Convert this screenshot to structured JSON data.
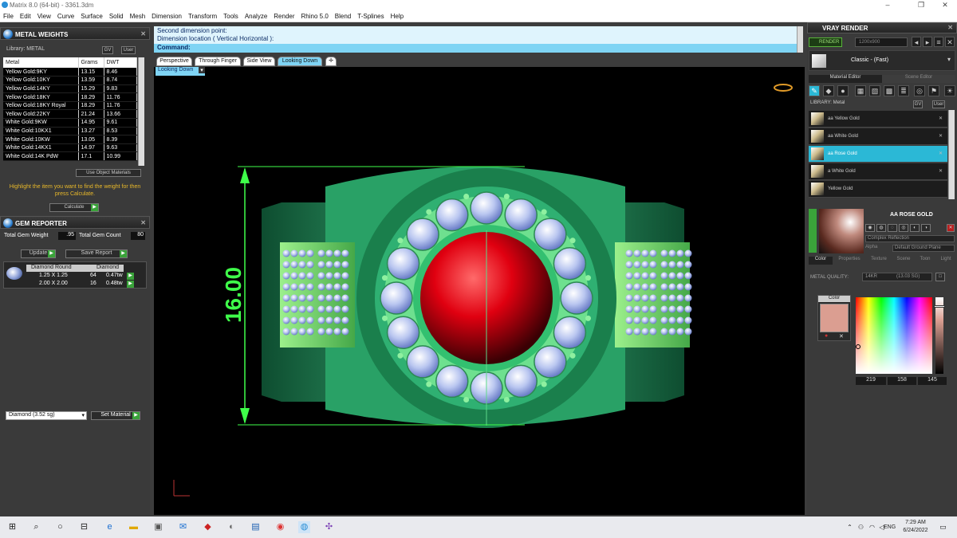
{
  "window": {
    "title": "Matrix 8.0 (64-bit) - 3361.3dm"
  },
  "menu": [
    "File",
    "Edit",
    "View",
    "Curve",
    "Surface",
    "Solid",
    "Mesh",
    "Dimension",
    "Transform",
    "Tools",
    "Analyze",
    "Render",
    "Rhino 5.0",
    "Blend",
    "T-Splines",
    "Help"
  ],
  "metal_weights": {
    "title": "METAL WEIGHTS",
    "library_label": "Library: METAL",
    "gv_label": "GV",
    "user_label": "User",
    "columns": [
      "Metal",
      "Grams",
      "DWT"
    ],
    "rows": [
      [
        "Yellow Gold:9KY",
        "13.15",
        "8.46"
      ],
      [
        "Yellow Gold:10KY",
        "13.59",
        "8.74"
      ],
      [
        "Yellow Gold:14KY",
        "15.29",
        "9.83"
      ],
      [
        "Yellow Gold:18KY",
        "18.29",
        "11.76"
      ],
      [
        "Yellow Gold:18KY Royal",
        "18.29",
        "11.76"
      ],
      [
        "Yellow Gold:22KY",
        "21.24",
        "13.66"
      ],
      [
        "White Gold:9KW",
        "14.95",
        "9.61"
      ],
      [
        "White Gold:10KX1",
        "13.27",
        "8.53"
      ],
      [
        "White Gold:10KW",
        "13.05",
        "8.39"
      ],
      [
        "White Gold:14KX1",
        "14.97",
        "9.63"
      ],
      [
        "White Gold:14K PdW",
        "17.1",
        "10.99"
      ]
    ],
    "use_object_materials": "Use Object Materials",
    "hint": "Highlight the item you want to find the weight for then press Calculate.",
    "calculate_label": "Calculate"
  },
  "gem_reporter": {
    "title": "GEM REPORTER",
    "total_weight_label": "Total Gem Weight",
    "total_weight_value": ".95",
    "total_count_label": "Total Gem Count",
    "total_count_value": "80",
    "update_label": "Update",
    "save_report_label": "Save Report",
    "group_cut": "Diamond Round",
    "group_material": "Diamond",
    "rows": [
      {
        "size": "1.25 X 1.25",
        "count": "64",
        "weight": "0.47tw"
      },
      {
        "size": "2.00 X 2.00",
        "count": "16",
        "weight": "0.48tw"
      }
    ],
    "material_select": "Diamond   (3.52 sg)",
    "set_material_label": "Set Material"
  },
  "command": {
    "line1": "Second dimension point:",
    "line2": "Dimension location ( Vertical  Horizontal ):",
    "prompt_label": "Command:"
  },
  "view_tabs": [
    "Perspective",
    "Through Finger",
    "Side View",
    "Looking Down"
  ],
  "active_view": "Looking Down",
  "viewport": {
    "dimension_text": "16.00"
  },
  "vray": {
    "title": "VRAY RENDER",
    "render_label": "RENDER",
    "resolution": "1200x900",
    "preset": "Classic - (Fast)",
    "material_editor_tab": "Material Editor",
    "scene_editor_tab": "Scene Editor",
    "library_label": "LIBRARY: Metal",
    "gv_label": "GV",
    "user_label": "User",
    "materials": [
      "aa Yellow Gold",
      "aa White Gold",
      "aa Rose Gold",
      "a White Gold",
      "Yellow Gold"
    ],
    "selected_material": "AA ROSE GOLD",
    "reflection_mode": "Complex Reflection",
    "alpha_label": "Alpha",
    "ground_plane": "Default Ground Plane",
    "subtabs": [
      "Color",
      "Properties",
      "Texture",
      "Scene",
      "Toon",
      "Light"
    ],
    "metal_quality_label": "METAL QUALITY:",
    "metal_quality_value": "14KR",
    "metal_quality_sg": "(13.03 SG)",
    "color_label": "Color",
    "rgb": [
      "219",
      "158",
      "145"
    ],
    "swatch_color": "#db9e91"
  },
  "taskbar": {
    "time": "7:29 AM",
    "date": "6/24/2022",
    "lang": "ENG"
  }
}
